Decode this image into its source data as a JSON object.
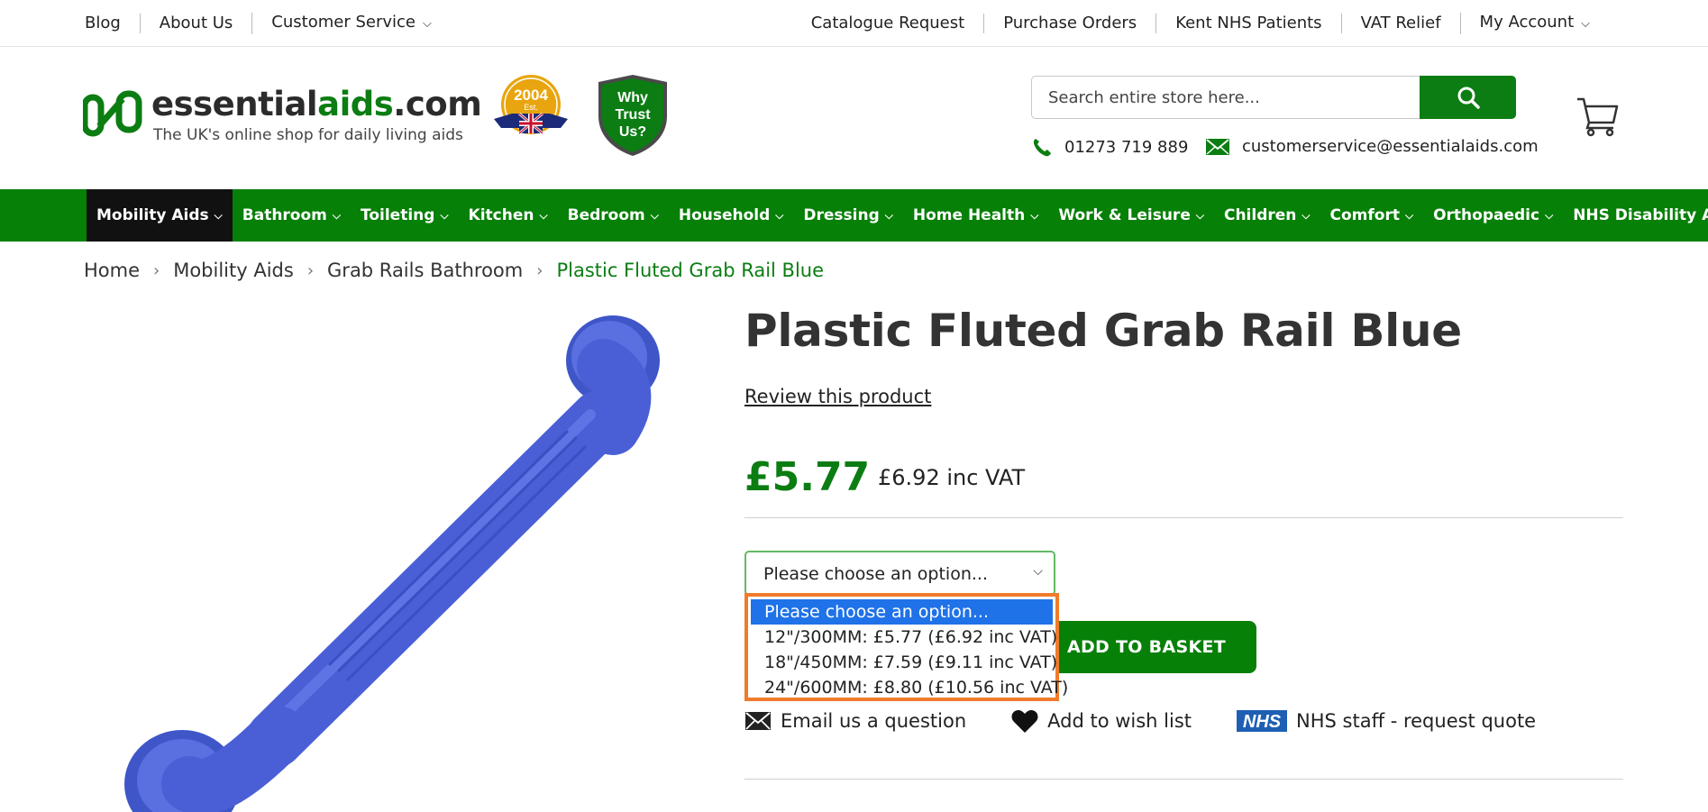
{
  "topbar": {
    "left_links": [
      {
        "label": "Blog"
      },
      {
        "label": "About Us"
      },
      {
        "label": "Customer Service"
      }
    ],
    "right_links": [
      {
        "label": "Catalogue Request"
      },
      {
        "label": "Purchase Orders"
      },
      {
        "label": "Kent NHS Patients"
      },
      {
        "label": "VAT Relief"
      },
      {
        "label": "My Account"
      }
    ]
  },
  "header": {
    "logo_word_1": "essential",
    "logo_word_2": "aids",
    "logo_word_3": ".com",
    "logo_tagline": "The UK's online shop for daily living aids",
    "badge_year": "2004",
    "badge_est": "Est.",
    "trust_line_1": "Why",
    "trust_line_2": "Trust",
    "trust_line_3": "Us?",
    "search_placeholder": "Search entire store here...",
    "phone": "01273 719 889",
    "email": "customerservice@essentialaids.com"
  },
  "nav": {
    "items": [
      {
        "label": "Mobility Aids"
      },
      {
        "label": "Bathroom"
      },
      {
        "label": "Toileting"
      },
      {
        "label": "Kitchen"
      },
      {
        "label": "Bedroom"
      },
      {
        "label": "Household"
      },
      {
        "label": "Dressing"
      },
      {
        "label": "Home Health"
      },
      {
        "label": "Work & Leisure"
      },
      {
        "label": "Children"
      },
      {
        "label": "Comfort"
      },
      {
        "label": "Orthopaedic"
      },
      {
        "label": "NHS Disability Aids"
      }
    ]
  },
  "breadcrumb": {
    "items": [
      "Home",
      "Mobility Aids",
      "Grab Rails Bathroom"
    ],
    "current": "Plastic Fluted Grab Rail Blue"
  },
  "product": {
    "title": "Plastic Fluted Grab Rail Blue",
    "review_link": "Review this product",
    "price": "£5.77",
    "price_inc_vat": "£6.92 inc VAT",
    "select_value": "Please choose an option...",
    "options": [
      "Please choose an option...",
      "12\"/300MM: £5.77 (£6.92 inc VAT)",
      "18\"/450MM: £7.59 (£9.11 inc VAT)",
      "24\"/600MM: £8.80 (£10.56 inc VAT)"
    ],
    "add_to_basket": "ADD TO BASKET",
    "actions": {
      "email": "Email us a question",
      "wishlist": "Add to wish list",
      "nhs_logo": "NHS",
      "nhs": "NHS staff - request quote"
    }
  },
  "colors": {
    "brand_green": "#078007",
    "text_green": "#0b7d12",
    "dropdown_highlight": "#1f72e8",
    "dropdown_border": "#f07b2b",
    "product_blue": "#4a5fd6"
  }
}
